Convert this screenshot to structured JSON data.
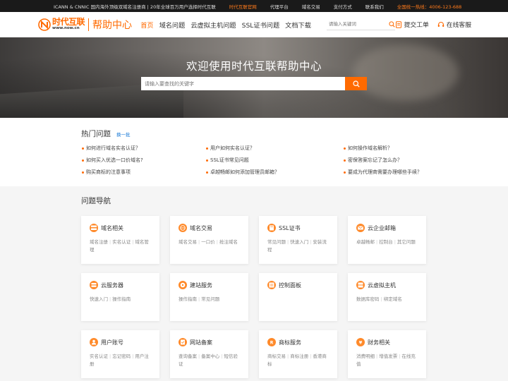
{
  "topbar": {
    "slogan": "ICANN & CNNIC 国内海外顶级双域名注册商 | 20年全球百万用户选择时代互联",
    "links": [
      "时代互联官网",
      "代理平台",
      "域名交易",
      "支付方式",
      "联系我们"
    ],
    "hotline": "全国统一热线：4006-123-688"
  },
  "header": {
    "logo_cn": "时代互联",
    "logo_en": "www.now.cn",
    "logo_help": "帮助中心",
    "nav": [
      "首页",
      "域名问题",
      "云虚拟主机问题",
      "SSL证书问题",
      "文档下载"
    ],
    "search_placeholder": "请输入关键词",
    "ticket_label": "提交工单",
    "service_label": "在线客服"
  },
  "banner": {
    "title": "欢迎使用时代互联帮助中心",
    "search_placeholder": "请输入要查找的关键字"
  },
  "hot": {
    "title": "热门问题",
    "refresh_label": "换一批",
    "items": [
      "如何进行域名实名认证？",
      "用户如何实名认证？",
      "如何操作域名解析？",
      "如何买入优选一口价域名?",
      "SSL证书常见问题",
      "密保答案忘记了怎么办？",
      "购买商标的注意事项",
      "卓越畅邮如何添加管理员邮箱？",
      "要成为代理商需要办理哪些手续？"
    ]
  },
  "qnav": {
    "title": "问题导航",
    "cards": [
      {
        "title": "域名相关",
        "icon": "server-stack-icon",
        "links": [
          "域名注册",
          "实名认证",
          "域名管理"
        ]
      },
      {
        "title": "域名交易",
        "icon": "globe-icon",
        "links": [
          "域名交易",
          "一口价",
          "抢注域名"
        ]
      },
      {
        "title": "SSL证书",
        "icon": "certificate-icon",
        "links": [
          "常见问题",
          "快速入门",
          "安装流程"
        ]
      },
      {
        "title": "云企业邮箱",
        "icon": "mail-icon",
        "links": [
          "卓越畅邮",
          "控制台",
          "其它问题"
        ]
      },
      {
        "title": "云服务器",
        "icon": "cloud-server-icon",
        "links": [
          "快速入门",
          "操作指南"
        ]
      },
      {
        "title": "建站服务",
        "icon": "website-icon",
        "links": [
          "操作指南",
          "常见问题"
        ]
      },
      {
        "title": "控制面板",
        "icon": "control-panel-icon",
        "links": []
      },
      {
        "title": "云虚拟主机",
        "icon": "virtual-host-icon",
        "links": [
          "数据库密码",
          "绑定域名"
        ]
      },
      {
        "title": "用户账号",
        "icon": "user-icon",
        "links": [
          "实名认证",
          "忘记密码",
          "用户注册"
        ]
      },
      {
        "title": "网站备案",
        "icon": "filing-icon",
        "links": [
          "查询备案",
          "备案中心",
          "短信验证"
        ]
      },
      {
        "title": "商标服务",
        "icon": "trademark-icon",
        "links": [
          "商标交易",
          "商标注册",
          "香港商标"
        ]
      },
      {
        "title": "财务相关",
        "icon": "finance-icon",
        "links": [
          "消费明细",
          "增值发票",
          "在线充值"
        ]
      }
    ]
  },
  "colors": {
    "accent": "#ff6a00",
    "topbar_bg": "#1a1a1a",
    "link_blue": "#1a7ad6"
  }
}
